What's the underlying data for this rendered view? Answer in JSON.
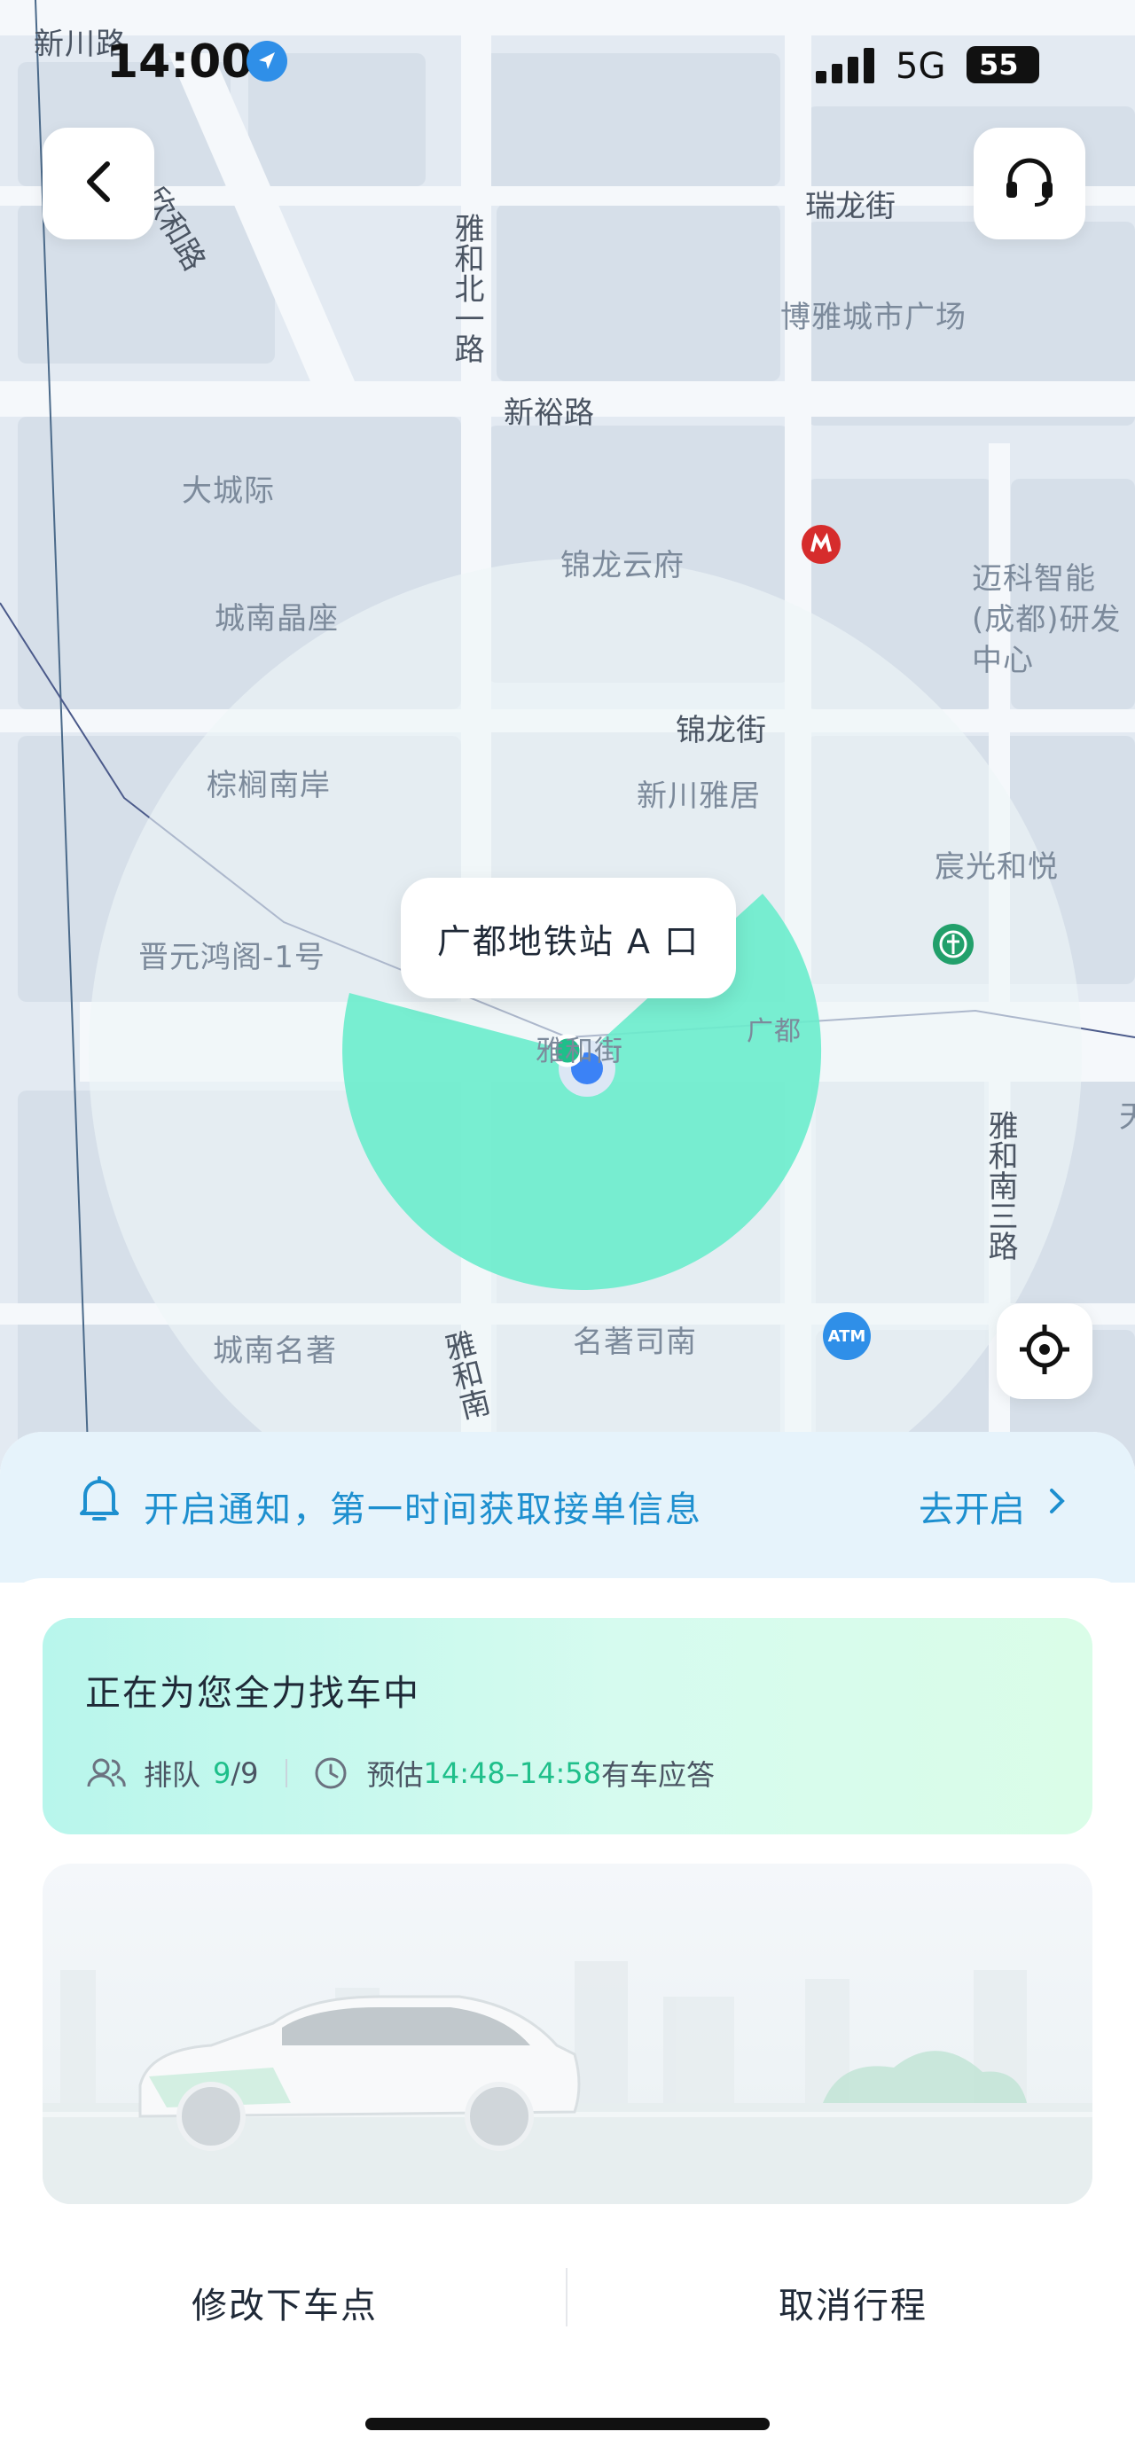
{
  "status_bar": {
    "time": "14:00",
    "network": "5G",
    "battery": "55"
  },
  "map": {
    "labels": {
      "xinchuan_road": "新川路",
      "xinhe_road": "欣和路",
      "yahe_north1": "雅和北一路",
      "xinyu_road": "新裕路",
      "ruilong_street": "瑞龙街",
      "boya_plaza": "博雅城市广场",
      "dachengji": "大城际",
      "jinlong_yunfu": "锦龙云府",
      "maike": "迈科智能(成都)研发中心",
      "chengnan_jingzuo": "城南晶座",
      "jinlong_street": "锦龙街",
      "zonglv_nanan": "棕榈南岸",
      "xinchuan_yaju": "新川雅居",
      "chenguang_heyue": "宸光和悦",
      "jinyuan_honge": "晋元鸿阁-1号",
      "guangdu_road": "广都",
      "yahe_street": "雅和街",
      "yahe_south3": "雅和南三路",
      "chengnan_mingzhu": "城南名著",
      "mingzhu_sinan": "名著司南",
      "yahe_south": "雅和南",
      "atm": "ATM",
      "right_edge": "天"
    },
    "pickup_bubble": "广都地铁站 A 口"
  },
  "icons": {
    "back": "chevron-left-icon",
    "support": "headset-icon",
    "locate": "crosshair-icon",
    "bell": "bell-icon",
    "arrow": "chevron-right-icon",
    "queue": "users-icon",
    "clock": "clock-icon"
  },
  "notify_banner": {
    "text": "开启通知，第一时间获取接单信息",
    "action": "去开启"
  },
  "status_card": {
    "title": "正在为您全力找车中",
    "queue_label": "排队",
    "queue_position": "9",
    "queue_total": "/9",
    "estimate_prefix": "预估",
    "estimate_time": "14:48–14:58",
    "estimate_suffix": "有车应答"
  },
  "actions": {
    "modify": "修改下车点",
    "cancel": "取消行程"
  },
  "colors": {
    "accent_blue": "#1d8fcf",
    "accent_green": "#1fbf8a",
    "radar_teal": "#5ee8c8"
  }
}
